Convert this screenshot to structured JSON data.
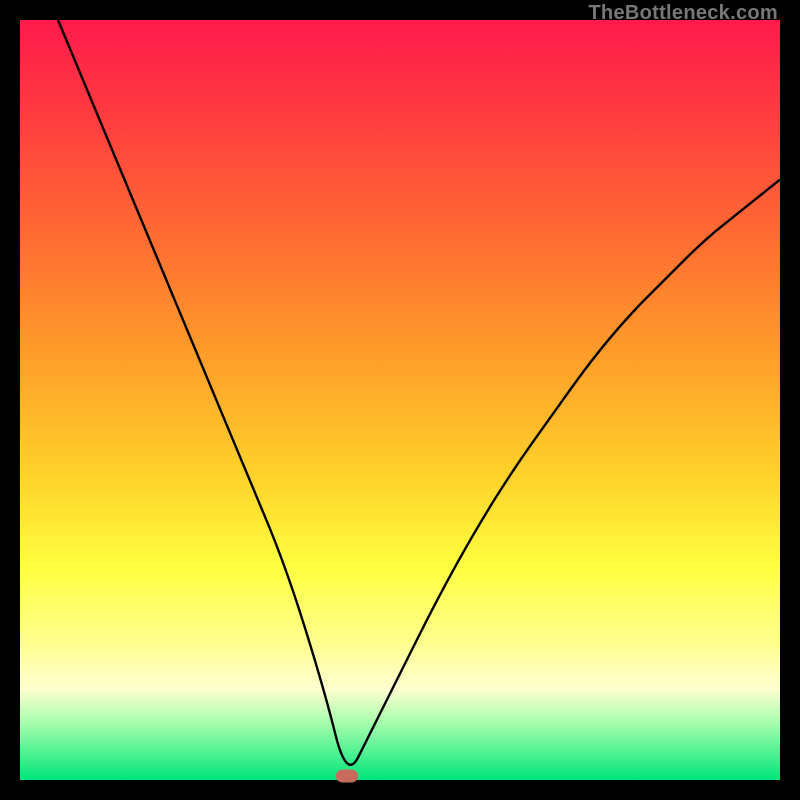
{
  "watermark_text": "TheBottleneck.com",
  "colors": {
    "frame": "#000000",
    "gradient_top": "#ff1a4b",
    "gradient_bottom": "#00e67a",
    "curve": "#000000",
    "marker": "#c96a5f"
  },
  "chart_data": {
    "type": "line",
    "title": "",
    "xlabel": "",
    "ylabel": "",
    "xlim": [
      0,
      100
    ],
    "ylim": [
      0,
      100
    ],
    "marker_at_minimum": {
      "x": 43,
      "y": 0
    },
    "series": [
      {
        "name": "bottleneck-curve",
        "x": [
          5,
          10,
          15,
          20,
          25,
          30,
          35,
          40,
          43,
          46,
          50,
          55,
          60,
          65,
          70,
          75,
          80,
          85,
          90,
          95,
          100
        ],
        "y": [
          100,
          88,
          76,
          64,
          52,
          40,
          28,
          12,
          0,
          6,
          14,
          24,
          33,
          41,
          48,
          55,
          61,
          66,
          71,
          75,
          79
        ]
      }
    ],
    "annotations": []
  }
}
